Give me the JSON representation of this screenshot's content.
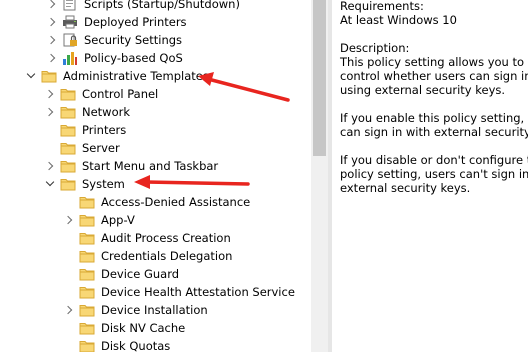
{
  "tree": {
    "items": [
      {
        "label": "Scripts (Startup/Shutdown)",
        "icon": "script-icon",
        "expander": "collapsed"
      },
      {
        "label": "Deployed Printers",
        "icon": "printer-icon",
        "expander": "collapsed"
      },
      {
        "label": "Security Settings",
        "icon": "security-icon",
        "expander": "collapsed"
      },
      {
        "label": "Policy-based QoS",
        "icon": "qos-chart-icon",
        "expander": "collapsed"
      },
      {
        "label": "Administrative Templates",
        "icon": "folder-icon",
        "expander": "expanded"
      },
      {
        "label": "Control Panel",
        "icon": "folder-icon",
        "expander": "collapsed"
      },
      {
        "label": "Network",
        "icon": "folder-icon",
        "expander": "collapsed"
      },
      {
        "label": "Printers",
        "icon": "folder-icon",
        "expander": "none"
      },
      {
        "label": "Server",
        "icon": "folder-icon",
        "expander": "none"
      },
      {
        "label": "Start Menu and Taskbar",
        "icon": "folder-icon",
        "expander": "collapsed"
      },
      {
        "label": "System",
        "icon": "folder-icon",
        "expander": "expanded"
      },
      {
        "label": "Access-Denied Assistance",
        "icon": "folder-icon",
        "expander": "none"
      },
      {
        "label": "App-V",
        "icon": "folder-icon",
        "expander": "collapsed"
      },
      {
        "label": "Audit Process Creation",
        "icon": "folder-icon",
        "expander": "none"
      },
      {
        "label": "Credentials Delegation",
        "icon": "folder-icon",
        "expander": "none"
      },
      {
        "label": "Device Guard",
        "icon": "folder-icon",
        "expander": "none"
      },
      {
        "label": "Device Health Attestation Service",
        "icon": "folder-icon",
        "expander": "none"
      },
      {
        "label": "Device Installation",
        "icon": "folder-icon",
        "expander": "collapsed"
      },
      {
        "label": "Disk NV Cache",
        "icon": "folder-icon",
        "expander": "none"
      },
      {
        "label": "Disk Quotas",
        "icon": "folder-icon",
        "expander": "none"
      }
    ]
  },
  "description": {
    "requirements_heading": "Requirements:",
    "requirements_value": "At least Windows 10",
    "description_heading": "Description:",
    "para1": [
      "This policy setting allows you to",
      "control whether users can sign in",
      "using external security keys."
    ],
    "para2": [
      "If you enable this policy setting, use",
      "can sign in with external security key"
    ],
    "para3": [
      "If you disable or don't configure thi",
      "policy setting, users can't sign in wit",
      "external security keys."
    ]
  },
  "colors": {
    "annotation_arrow": "#e8251f",
    "folder_fill": "#f8d775",
    "folder_edge": "#d9a935"
  }
}
